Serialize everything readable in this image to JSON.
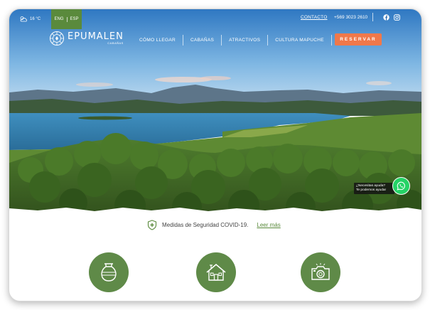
{
  "topbar": {
    "temperature": "16 °C",
    "lang_en": "ENG",
    "lang_es": "ESP",
    "contact_label": "CONTACTO",
    "phone": "+569 3023 2610"
  },
  "brand": {
    "name": "EPUMALEN",
    "tagline": "CABAÑAS"
  },
  "nav": {
    "items": [
      "CÓMO LLEGAR",
      "CABAÑAS",
      "ATRACTIVOS",
      "CULTURA MAPUCHE"
    ],
    "reserve_label": "RESERVAR"
  },
  "help_widget": {
    "line1": "¿Necesitas ayuda?",
    "line2": "Te podemos ayudar"
  },
  "covid": {
    "text": "Medidas de Seguridad COVID-19.",
    "link": "Leer más"
  },
  "features": [
    {
      "icon": "pottery-vase-icon"
    },
    {
      "icon": "house-icon"
    },
    {
      "icon": "camera-icon"
    }
  ],
  "colors": {
    "brand_green": "#5a8a3c",
    "feature_green": "#5f8a48",
    "reserve_orange": "#f0784a",
    "whatsapp": "#25d366"
  }
}
